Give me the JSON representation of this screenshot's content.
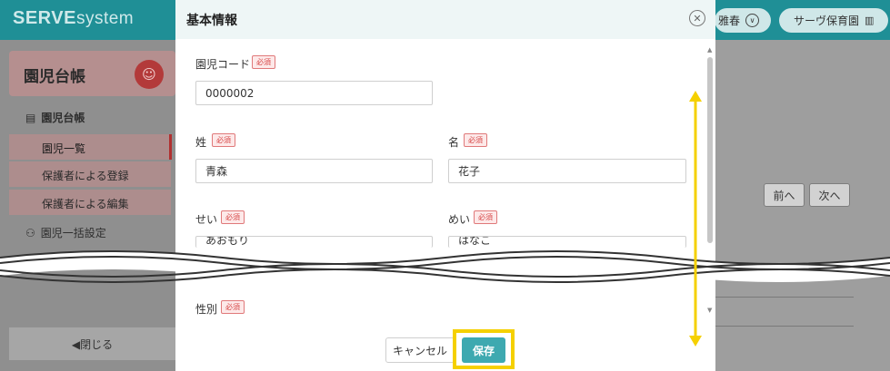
{
  "app": {
    "logo_bold": "SERVE",
    "logo_rest": "system",
    "user_name": "雅春",
    "school_name": "サーヴ保育園"
  },
  "sidebar": {
    "section_title": "園児台帳",
    "group_label": "園児台帳",
    "items": [
      {
        "label": "園児一覧",
        "active": true
      },
      {
        "label": "保護者による登録"
      },
      {
        "label": "保護者による編集"
      }
    ],
    "bulk_settings_label": "園児一括設定",
    "close_label": "◀閉じる"
  },
  "background_nav": {
    "prev_label": "前へ",
    "next_label": "次へ"
  },
  "modal": {
    "title": "基本情報",
    "required_badge": "必須",
    "fields": {
      "child_code": {
        "label": "園児コード",
        "value": "0000002"
      },
      "last_name": {
        "label": "姓",
        "value": "青森"
      },
      "first_name": {
        "label": "名",
        "value": "花子"
      },
      "last_name_kana": {
        "label": "せい",
        "value": "あおもり"
      },
      "first_name_kana": {
        "label": "めい",
        "value": "はなこ"
      },
      "gender": {
        "label": "性別"
      }
    },
    "cancel_label": "キャンセル",
    "save_label": "保存"
  },
  "colors": {
    "header": "#1f8f96",
    "save_button": "#3ea9b0",
    "highlight": "#f5d000",
    "required": "#d64545"
  }
}
